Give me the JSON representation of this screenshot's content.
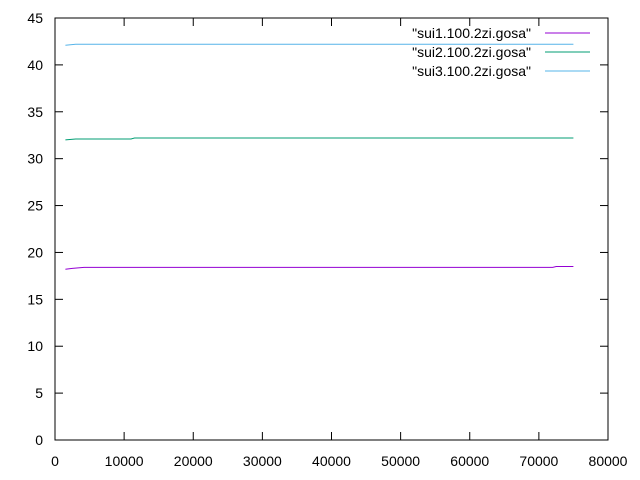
{
  "chart_data": {
    "type": "line",
    "title": "",
    "xlabel": "",
    "ylabel": "",
    "xlim": [
      0,
      80000
    ],
    "ylim": [
      0,
      45
    ],
    "x_ticks": [
      0,
      10000,
      20000,
      30000,
      40000,
      50000,
      60000,
      70000,
      80000
    ],
    "y_ticks": [
      0,
      5,
      10,
      15,
      20,
      25,
      30,
      35,
      40,
      45
    ],
    "grid": false,
    "legend_position": "top-right",
    "series": [
      {
        "name": "\"sui1.100.2zi.gosa\"",
        "color": "#9400d3",
        "points": [
          [
            1500,
            18.2
          ],
          [
            2500,
            18.3
          ],
          [
            4200,
            18.4
          ],
          [
            20000,
            18.4
          ],
          [
            40000,
            18.4
          ],
          [
            60000,
            18.4
          ],
          [
            72000,
            18.4
          ],
          [
            72500,
            18.5
          ],
          [
            75000,
            18.5
          ]
        ]
      },
      {
        "name": "\"sui2.100.2zi.gosa\"",
        "color": "#009e73",
        "points": [
          [
            1500,
            32.0
          ],
          [
            3000,
            32.1
          ],
          [
            11000,
            32.1
          ],
          [
            11500,
            32.2
          ],
          [
            30000,
            32.2
          ],
          [
            50000,
            32.2
          ],
          [
            75000,
            32.2
          ]
        ]
      },
      {
        "name": "\"sui3.100.2zi.gosa\"",
        "color": "#56b4e9",
        "points": [
          [
            1500,
            42.1
          ],
          [
            3000,
            42.2
          ],
          [
            20000,
            42.2
          ],
          [
            40000,
            42.2
          ],
          [
            60000,
            42.2
          ],
          [
            75000,
            42.2
          ]
        ]
      }
    ]
  }
}
